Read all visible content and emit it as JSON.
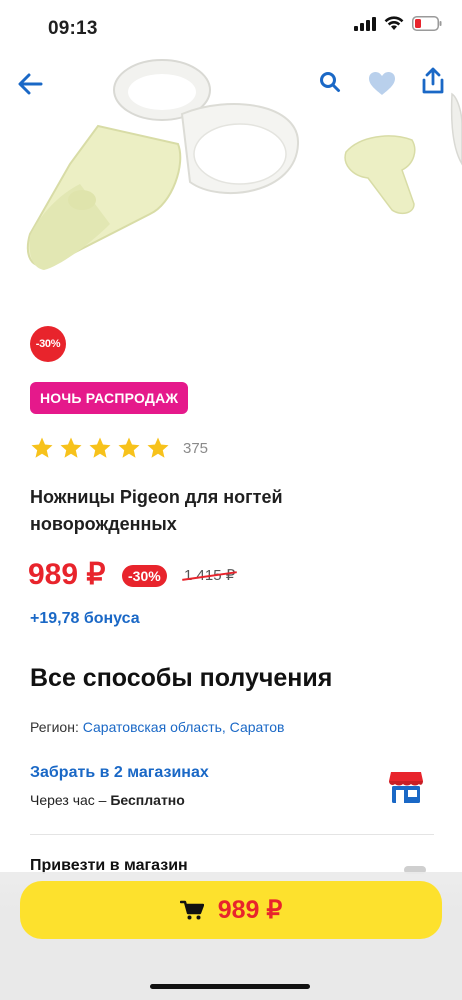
{
  "status_bar": {
    "time": "09:13"
  },
  "header": {
    "back_icon": "arrow-left-icon",
    "search_icon": "search-icon",
    "favorite_icon": "heart-icon",
    "share_icon": "share-icon"
  },
  "product": {
    "discount_badge": "-30%",
    "promo_label": "НОЧЬ РАСПРОДАЖ",
    "rating": {
      "stars": 5,
      "reviews_count": "375"
    },
    "title": "Ножницы Pigeon для ногтей новорожденных",
    "price": "989 ₽",
    "price_discount": "-30%",
    "old_price": "1 415 ₽",
    "bonus": "+19,78 бонуса"
  },
  "delivery": {
    "section_title": "Все способы получения",
    "region_label": "Регион:",
    "region_value": "Саратовская область, Саратов",
    "pickup_link": "Забрать в 2 магазинах",
    "pickup_time": "Через час",
    "pickup_sep": " – ",
    "pickup_cost": "Бесплатно",
    "store_icon": "store-icon",
    "deliver_to_store": "Привезти в магазин"
  },
  "buy_bar": {
    "cart_icon": "cart-icon",
    "price": "989 ₽"
  },
  "colors": {
    "accent_blue": "#1a68c6",
    "sale_red": "#e8242c",
    "promo_pink": "#e5198b",
    "buy_yellow": "#fde12d",
    "star_yellow": "#f7c21b"
  }
}
